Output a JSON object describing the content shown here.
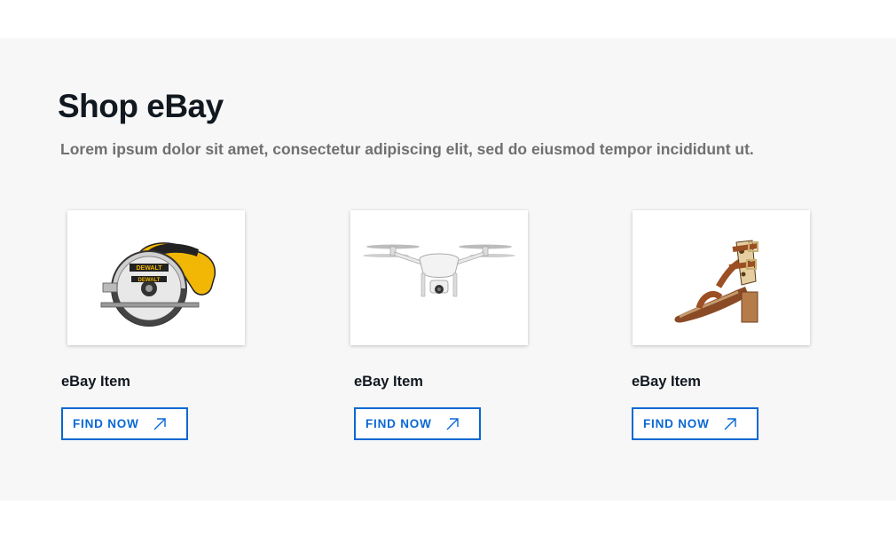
{
  "section": {
    "title": "Shop eBay",
    "subtitle": "Lorem ipsum dolor sit amet, consectetur adipiscing elit, sed do eiusmod tempor incididunt ut."
  },
  "cards": [
    {
      "name": "eBay Item",
      "button": "FIND NOW",
      "image": "circular-saw",
      "brand_text": "DEWALT"
    },
    {
      "name": "eBay Item",
      "button": "FIND NOW",
      "image": "drone"
    },
    {
      "name": "eBay Item",
      "button": "FIND NOW",
      "image": "sandal"
    }
  ],
  "colors": {
    "background": "#f7f7f7",
    "accent": "#0968d4",
    "title": "#111820",
    "subtitle": "#707070"
  }
}
